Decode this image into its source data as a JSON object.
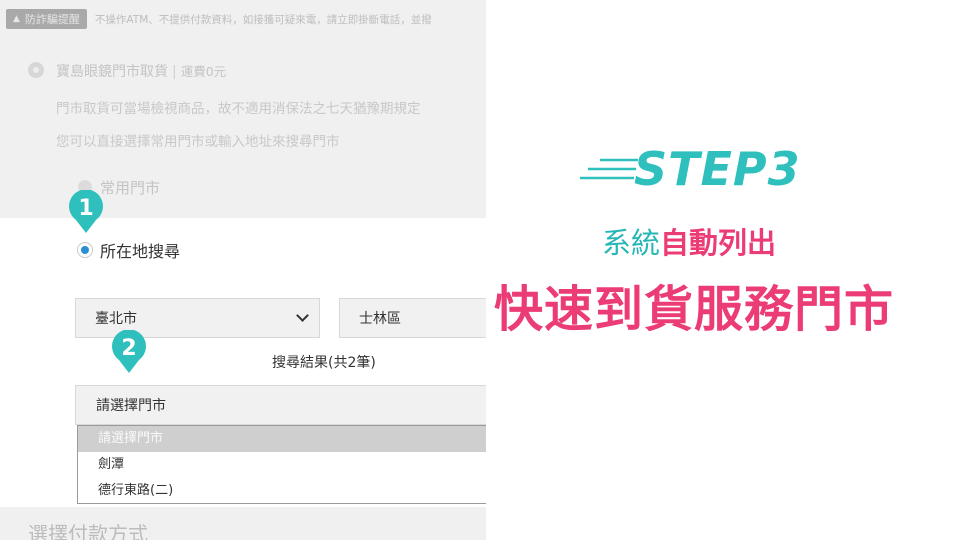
{
  "notice": {
    "badge": "防詐騙提醒",
    "text": "不操作ATM、不提供付款資料，如接獲可疑來電，請立即掛斷電話，並撥"
  },
  "store_pickup": {
    "title": "寶島眼鏡門市取貨",
    "fee": "運費0元",
    "note1": "門市取貨可當場檢視商品，故不適用消保法之七天猶豫期規定",
    "note2": "您可以直接選擇常用門市或輸入地址來搜尋門市"
  },
  "options": {
    "common": "常用門市",
    "search": "所在地搜尋"
  },
  "selects": {
    "city": "臺北市",
    "district": "士林區"
  },
  "result_text": "搜尋結果(共2筆)",
  "store_select": {
    "value": "請選擇門市",
    "options": [
      "請選擇門市",
      "劍潭",
      "德行東路(二)"
    ],
    "selected_index": 0
  },
  "payment_title": "選擇付款方式",
  "markers": [
    "1",
    "2"
  ],
  "caption": {
    "step": "STEP3",
    "line1_a": "系統",
    "line1_b": "自動列出",
    "line2": "快速到貨服務門市"
  },
  "colors": {
    "teal": "#2fc0be",
    "pink": "#ec3c76",
    "radio_blue": "#2b8fd3"
  }
}
